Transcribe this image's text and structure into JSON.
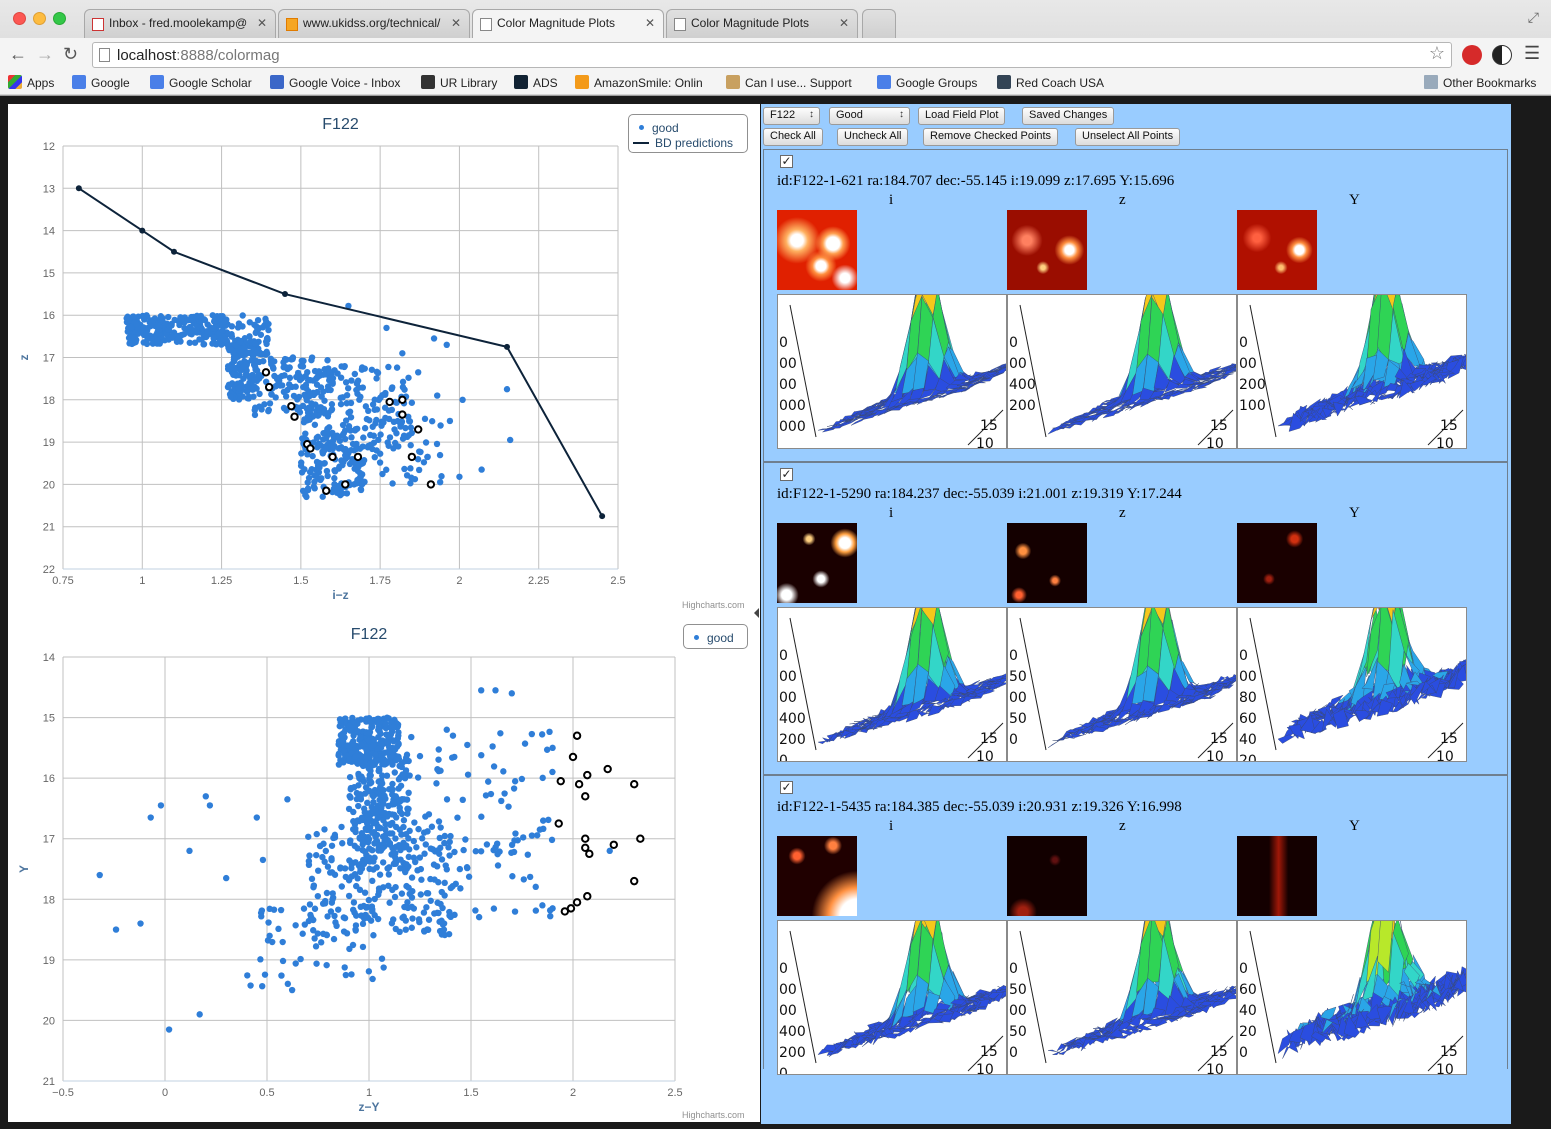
{
  "browser": {
    "tabs": [
      {
        "title": "Inbox - fred.moolekamp@"
      },
      {
        "title": "www.ukidss.org/technical/"
      },
      {
        "title": "Color Magnitude Plots"
      },
      {
        "title": "Color Magnitude Plots"
      }
    ],
    "url_host": "localhost",
    "url_rest": ":8888/colormag",
    "bookmarks": [
      "Apps",
      "Google",
      "Google Scholar",
      "Google Voice - Inbox",
      "UR Library",
      "ADS",
      "AmazonSmile: Onlin",
      "Can I use... Support",
      "Google Groups",
      "Red Coach USA"
    ],
    "other_bookmarks": "Other Bookmarks"
  },
  "charts": [
    {
      "title": "F122",
      "legend_good": "good",
      "legend_bd": "BD predictions",
      "credit": "Highcharts.com"
    },
    {
      "title": "F122",
      "legend_good": "good",
      "credit": "Highcharts.com"
    }
  ],
  "chart_data": [
    {
      "type": "scatter",
      "title": "F122",
      "xlabel": "i−z",
      "ylabel": "z",
      "xlim": [
        0.75,
        2.5
      ],
      "ylim": [
        12,
        22
      ],
      "y_reversed": true,
      "x_ticks": [
        "0.75",
        "1",
        "1.25",
        "1.5",
        "1.75",
        "2",
        "2.25",
        "2.5"
      ],
      "y_ticks": [
        "12",
        "13",
        "14",
        "15",
        "16",
        "17",
        "18",
        "19",
        "20",
        "21",
        "22"
      ],
      "legend": "top-right",
      "colors": {
        "good": "#2f7ed8",
        "bd": "#0d233a",
        "selected_stroke": "#000000"
      },
      "series": [
        {
          "name": "good",
          "kind": "scatter",
          "dense_regions": [
            {
              "x": [
                0.95,
                1.27
              ],
              "y": [
                16.0,
                16.7
              ],
              "n": 260
            },
            {
              "x": [
                1.27,
                1.4
              ],
              "y": [
                16.0,
                17.0
              ],
              "n": 60
            },
            {
              "x": [
                1.27,
                1.37
              ],
              "y": [
                16.6,
                18.0
              ],
              "n": 150
            },
            {
              "x": [
                1.35,
                1.6
              ],
              "y": [
                17.0,
                18.4
              ],
              "n": 130
            },
            {
              "x": [
                1.5,
                1.85
              ],
              "y": [
                17.2,
                19.2
              ],
              "n": 150
            },
            {
              "x": [
                1.5,
                1.7
              ],
              "y": [
                18.8,
                20.3
              ],
              "n": 130
            },
            {
              "x": [
                1.6,
                1.95
              ],
              "y": [
                18.2,
                20.0
              ],
              "n": 60
            }
          ],
          "points": [
            [
              1.65,
              15.78
            ],
            [
              1.77,
              16.3
            ],
            [
              1.92,
              16.55
            ],
            [
              2.15,
              17.75
            ],
            [
              1.93,
              17.9
            ],
            [
              2.01,
              18.0
            ],
            [
              1.97,
              18.5
            ],
            [
              2.16,
              18.95
            ],
            [
              2.07,
              19.65
            ],
            [
              2.0,
              19.82
            ],
            [
              1.87,
              17.35
            ],
            [
              1.82,
              16.9
            ],
            [
              1.73,
              18.85
            ],
            [
              1.9,
              19.35
            ],
            [
              1.96,
              16.7
            ]
          ]
        },
        {
          "name": "BD predictions",
          "kind": "line",
          "points": [
            [
              0.8,
              13
            ],
            [
              1.0,
              14
            ],
            [
              1.1,
              14.5
            ],
            [
              1.45,
              15.5
            ],
            [
              2.15,
              16.75
            ],
            [
              2.45,
              20.75
            ]
          ]
        },
        {
          "name": "selected",
          "kind": "open-circles",
          "points": [
            [
              1.39,
              17.35
            ],
            [
              1.4,
              17.7
            ],
            [
              1.47,
              18.15
            ],
            [
              1.48,
              18.4
            ],
            [
              1.52,
              19.05
            ],
            [
              1.53,
              19.15
            ],
            [
              1.6,
              19.35
            ],
            [
              1.64,
              20.0
            ],
            [
              1.58,
              20.15
            ],
            [
              1.68,
              19.35
            ],
            [
              1.78,
              18.05
            ],
            [
              1.82,
              18.0
            ],
            [
              1.82,
              18.35
            ],
            [
              1.87,
              18.7
            ],
            [
              1.85,
              19.35
            ],
            [
              1.91,
              20.0
            ]
          ]
        }
      ]
    },
    {
      "type": "scatter",
      "title": "F122",
      "xlabel": "z−Y",
      "ylabel": "Y",
      "xlim": [
        -0.5,
        2.5
      ],
      "ylim": [
        14,
        21
      ],
      "y_reversed": true,
      "x_ticks": [
        "−0.5",
        "0",
        "0.5",
        "1",
        "1.5",
        "2",
        "2.5"
      ],
      "y_ticks": [
        "14",
        "15",
        "16",
        "17",
        "18",
        "19",
        "20",
        "21"
      ],
      "legend": "top-right",
      "colors": {
        "good": "#2f7ed8",
        "selected_stroke": "#000000"
      },
      "series": [
        {
          "name": "good",
          "kind": "scatter",
          "dense_regions": [
            {
              "x": [
                0.85,
                1.15
              ],
              "y": [
                15.0,
                15.8
              ],
              "n": 240
            },
            {
              "x": [
                0.9,
                1.2
              ],
              "y": [
                15.6,
                17.5
              ],
              "n": 260
            },
            {
              "x": [
                0.7,
                1.4
              ],
              "y": [
                16.8,
                18.6
              ],
              "n": 200
            },
            {
              "x": [
                0.4,
                1.1
              ],
              "y": [
                18.0,
                19.5
              ],
              "n": 60
            },
            {
              "x": [
                1.2,
                1.9
              ],
              "y": [
                15.2,
                18.3
              ],
              "n": 110
            }
          ],
          "points": [
            [
              -0.32,
              17.6
            ],
            [
              -0.24,
              18.5
            ],
            [
              -0.12,
              18.4
            ],
            [
              -0.07,
              16.65
            ],
            [
              -0.02,
              16.45
            ],
            [
              0.02,
              20.15
            ],
            [
              0.12,
              17.2
            ],
            [
              0.17,
              19.9
            ],
            [
              0.2,
              16.3
            ],
            [
              0.22,
              16.45
            ],
            [
              0.3,
              17.65
            ],
            [
              0.45,
              16.65
            ],
            [
              0.48,
              17.35
            ],
            [
              0.6,
              16.35
            ],
            [
              1.55,
              14.55
            ],
            [
              1.62,
              14.55
            ],
            [
              1.7,
              14.6
            ],
            [
              1.9,
              15.5
            ],
            [
              2.18,
              17.2
            ],
            [
              1.85,
              18.1
            ],
            [
              1.9,
              18.15
            ]
          ]
        },
        {
          "name": "selected",
          "kind": "open-circles",
          "points": [
            [
              2.02,
              15.3
            ],
            [
              2.0,
              15.65
            ],
            [
              2.03,
              16.1
            ],
            [
              2.07,
              15.95
            ],
            [
              2.17,
              15.85
            ],
            [
              2.3,
              16.1
            ],
            [
              2.06,
              16.3
            ],
            [
              1.94,
              16.05
            ],
            [
              1.93,
              16.75
            ],
            [
              2.06,
              17.0
            ],
            [
              2.06,
              17.15
            ],
            [
              2.08,
              17.25
            ],
            [
              2.2,
              17.1
            ],
            [
              2.33,
              17.0
            ],
            [
              2.3,
              17.7
            ],
            [
              2.07,
              17.95
            ],
            [
              2.02,
              18.05
            ],
            [
              1.99,
              18.15
            ],
            [
              1.96,
              18.2
            ]
          ]
        }
      ]
    }
  ],
  "controls": {
    "field_select": "F122",
    "status_select": "Good",
    "load_field_plot": "Load Field Plot",
    "saved_changes": "Saved Changes",
    "check_all": "Check All",
    "uncheck_all": "Uncheck All",
    "remove_checked": "Remove Checked Points",
    "unselect_all": "Unselect All Points"
  },
  "objects": [
    {
      "checked": true,
      "info": "id:F122-1-621 ra:184.707 dec:-55.145 i:19.099 z:17.695 Y:15.696",
      "bands": [
        "i",
        "z",
        "Y"
      ],
      "surface_axes": [
        {
          "left": [
            "0",
            "00",
            "00",
            "000",
            "000"
          ],
          "bottom": [
            "15",
            "10"
          ]
        },
        {
          "left": [
            "0",
            "00",
            "400",
            "200"
          ],
          "bottom": [
            "15",
            "10"
          ]
        },
        {
          "left": [
            "0",
            "00",
            "200",
            "100"
          ],
          "bottom": [
            "15",
            "10"
          ]
        }
      ]
    },
    {
      "checked": true,
      "info": "id:F122-1-5290 ra:184.237 dec:-55.039 i:21.001 z:19.319 Y:17.244",
      "bands": [
        "i",
        "z",
        "Y"
      ],
      "surface_axes": [
        {
          "left": [
            "0",
            "00",
            "00",
            "400",
            "200",
            "0"
          ],
          "bottom": [
            "15",
            "10"
          ]
        },
        {
          "left": [
            "0",
            "50",
            "00",
            "50",
            "0"
          ],
          "bottom": [
            "15",
            "10"
          ]
        },
        {
          "left": [
            "0",
            "00",
            "80",
            "60",
            "40",
            "20"
          ],
          "bottom": [
            "15",
            "10"
          ]
        }
      ]
    },
    {
      "checked": true,
      "info": "id:F122-1-5435 ra:184.385 dec:-55.039 i:20.931 z:19.326 Y:16.998",
      "bands": [
        "i",
        "z",
        "Y"
      ],
      "surface_axes": [
        {
          "left": [
            "0",
            "00",
            "00",
            "400",
            "200",
            "0"
          ],
          "bottom": [
            "15",
            "10"
          ]
        },
        {
          "left": [
            "0",
            "50",
            "00",
            "50",
            "0"
          ],
          "bottom": [
            "15",
            "10"
          ]
        },
        {
          "left": [
            "0",
            "60",
            "40",
            "20",
            "0"
          ],
          "bottom": [
            "15",
            "10"
          ]
        }
      ]
    }
  ]
}
